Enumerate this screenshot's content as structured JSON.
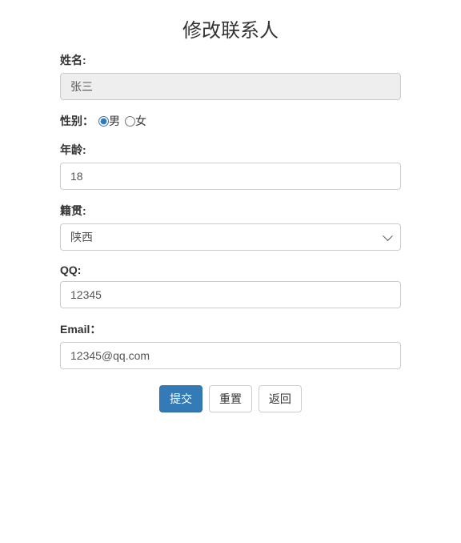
{
  "title": "修改联系人",
  "fields": {
    "name": {
      "label": "姓名:",
      "value": "张三"
    },
    "gender": {
      "label": "性别：",
      "options": {
        "male": "男",
        "female": "女"
      },
      "selected": "male"
    },
    "age": {
      "label": "年龄:",
      "value": "18"
    },
    "province": {
      "label": "籍贯:",
      "value": "陕西"
    },
    "qq": {
      "label": "QQ:",
      "value": "12345"
    },
    "email": {
      "label": "Email：",
      "value": "12345@qq.com"
    }
  },
  "buttons": {
    "submit": "提交",
    "reset": "重置",
    "back": "返回"
  }
}
